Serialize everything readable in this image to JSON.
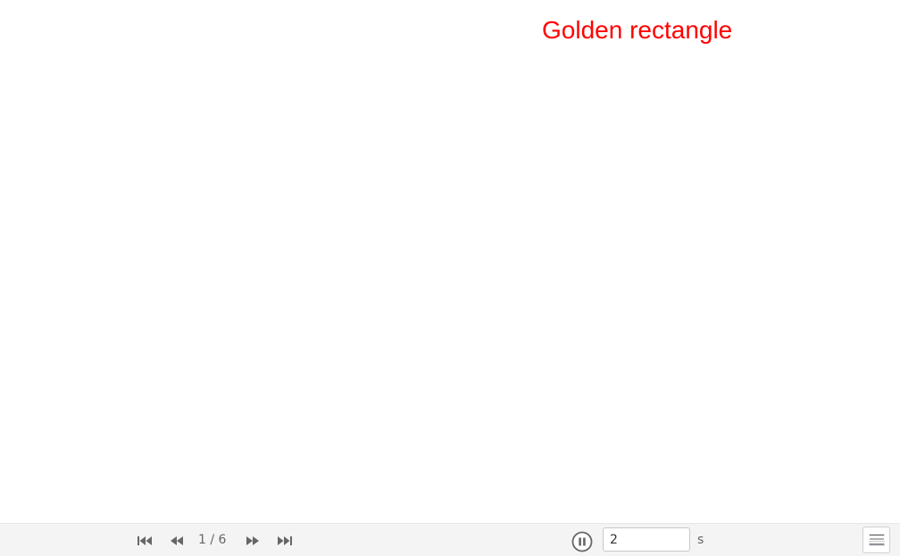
{
  "canvas": {
    "title": "Golden rectangle",
    "title_color": "#ff0000"
  },
  "navigation": {
    "step_indicator": "1 / 6",
    "first_icon": "skip-first-icon",
    "previous_icon": "previous-icon",
    "next_icon": "next-icon",
    "last_icon": "skip-last-icon"
  },
  "playback": {
    "pause_icon": "pause-icon",
    "speed_value": "2",
    "speed_unit": "s"
  },
  "algebra_toggle": {
    "icon": "algebra-view-icon"
  }
}
